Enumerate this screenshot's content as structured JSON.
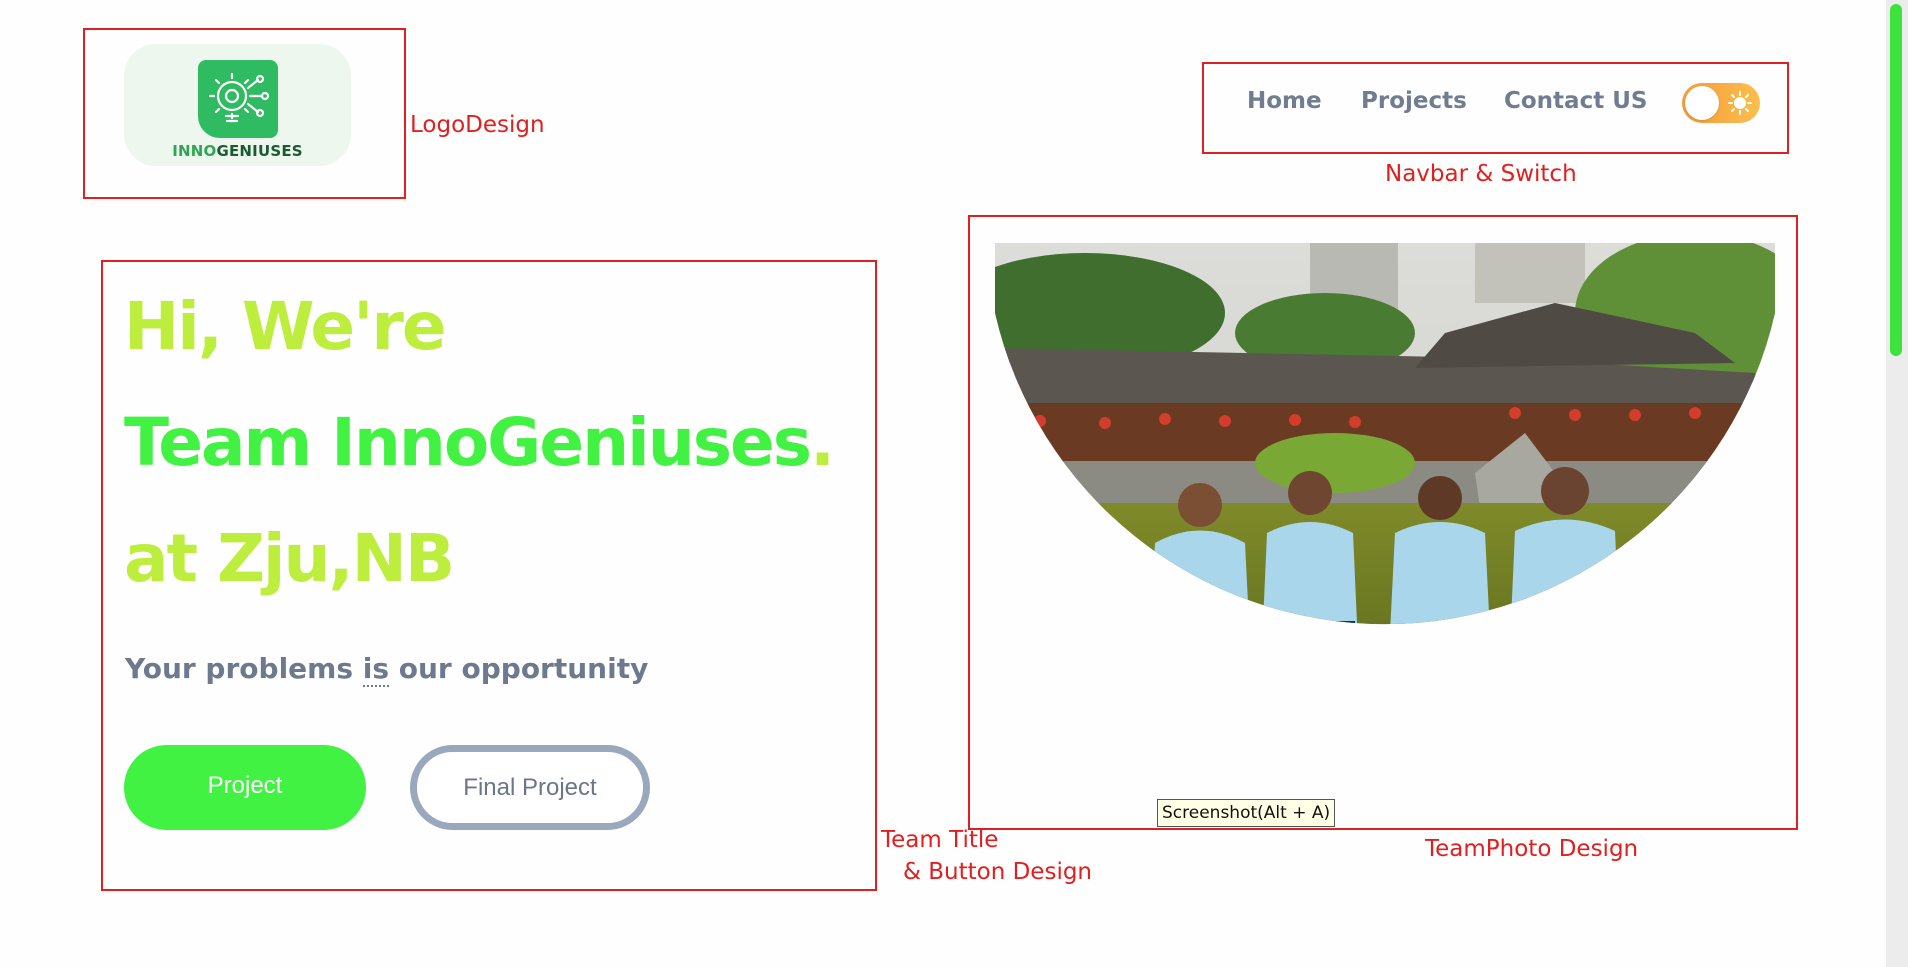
{
  "logo": {
    "text_part1": "INNO",
    "text_part2": "GENIUSES",
    "icon": "gear-lightbulb-icon",
    "colors": {
      "card": "#edf7ed",
      "mark": "#2fbb61",
      "inno": "#2fa653",
      "geniuses": "#1b5a34"
    }
  },
  "nav": {
    "items": [
      {
        "label": "Home"
      },
      {
        "label": "Projects"
      },
      {
        "label": "Contact US"
      }
    ],
    "theme_toggle": {
      "state": "light",
      "icon": "sun-icon"
    }
  },
  "hero": {
    "line1": "Hi, We're",
    "line2": "Team InnoGeniuses",
    "line2_dot": ".",
    "line3": "at Zju,NB",
    "tagline_before": "Your problems ",
    "tagline_is": "is",
    "tagline_after": " our opportunity",
    "primary_button": "Project",
    "secondary_button": "Final Project",
    "colors": {
      "lime": "#bdee3e",
      "green": "#42f242",
      "muted": "#6d7a8d"
    }
  },
  "team_photo": {
    "description": "team-photo"
  },
  "tooltip": "Screenshot(Alt + A)",
  "annotations": {
    "logo": "LogoDesign",
    "navbar": "Navbar & Switch",
    "team_title_line1": "Team Title",
    "team_title_line2": "& Button Design",
    "team_photo": "TeamPhoto Design"
  },
  "colors": {
    "annotation_red": "#e02020",
    "scroll_thumb": "#3de23d"
  }
}
